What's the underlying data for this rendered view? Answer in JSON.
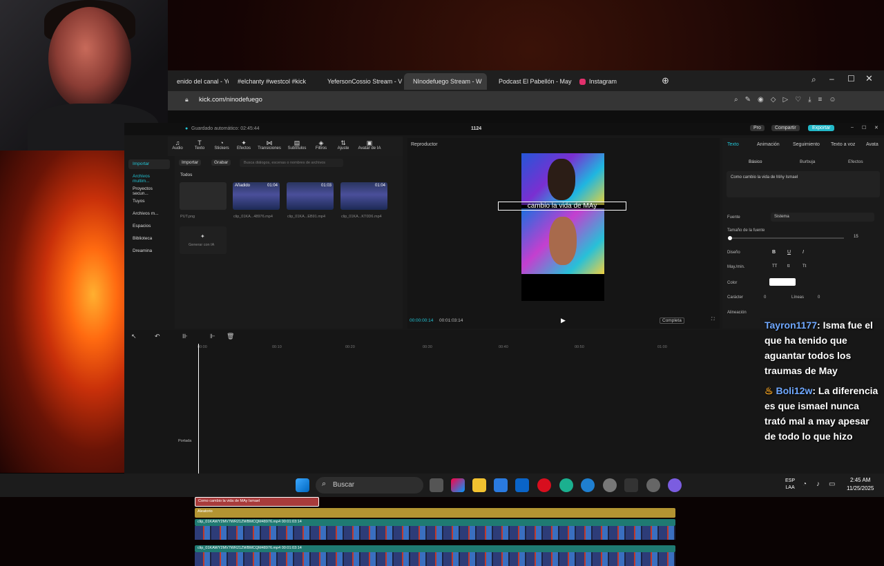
{
  "browser": {
    "tabs": [
      {
        "label": "enido del canal - You",
        "color": "#ff0000"
      },
      {
        "label": "#elchanty #westcol #kick",
        "color": "#ffffff"
      },
      {
        "label": "YefersonCossio Stream - V",
        "color": "#53fc18"
      },
      {
        "label": "NInodefuego Stream - W",
        "color": "#53fc18"
      },
      {
        "label": "Podcast El Pabellón - May",
        "color": "#ff0000"
      },
      {
        "label": "Instagram",
        "color": "#e1306c"
      }
    ],
    "url": "kick.com/ninodefuego"
  },
  "capcut": {
    "autosave": "Guardado automático: 02:45:44",
    "project": "1124",
    "pro": "Pro",
    "share": "Compartir",
    "export": "Exportar",
    "tools": [
      {
        "icon": "♫",
        "label": "Audio"
      },
      {
        "icon": "T",
        "label": "Texto"
      },
      {
        "icon": "◔",
        "label": "Stickers"
      },
      {
        "icon": "✦",
        "label": "Efectos"
      },
      {
        "icon": "⋈",
        "label": "Transiciones"
      },
      {
        "icon": "▤",
        "label": "Subtítulos"
      },
      {
        "icon": "◈",
        "label": "Filtros"
      },
      {
        "icon": "⇅",
        "label": "Ajuste"
      },
      {
        "icon": "▣",
        "label": "Avatar de IA"
      }
    ],
    "sidebar": [
      "Importar",
      "Archivos multim...",
      "Proyectos secun...",
      "Tuyos",
      "Archivos m...",
      "Espacios",
      "Biblioteca",
      "Dreamina"
    ],
    "media": {
      "import": "Importar",
      "record": "Grabar",
      "search_placeholder": "Busca diálogos, escenas o nombres de archivos",
      "all": "Todos",
      "items": [
        {
          "name": "PUT.png",
          "badge": "",
          "dur": ""
        },
        {
          "name": "clip_01KA...48976.mp4",
          "badge": "Añadido",
          "dur": "01:04"
        },
        {
          "name": "clip_01KA...EB91.mp4",
          "badge": "",
          "dur": "01:03"
        },
        {
          "name": "clip_01KA...KT0D6.mp4",
          "badge": "",
          "dur": "01:04"
        }
      ],
      "generate": "Generar con IA"
    },
    "player": {
      "title": "Reproductor",
      "subtitle": "cambio la vida de MAy",
      "current": "00:00:00:14",
      "total": "00:01:03:14",
      "ratio": "Completa"
    },
    "props": {
      "tabs": [
        "Texto",
        "Animación",
        "Seguimiento",
        "Texto a voz",
        "Avata"
      ],
      "subtabs": [
        "Básico",
        "Burbuja",
        "Efectos"
      ],
      "text_value": "Como cambio la vida de MAy Ismael",
      "font_label": "Fuente",
      "font_value": "Sistema",
      "size_label": "Tamaño de la fuente",
      "size_value": "15",
      "design_label": "Diseño",
      "case_label": "May./min.",
      "color_label": "Color",
      "char_label": "Carácter",
      "char_value": "0",
      "lines_label": "Líneas",
      "lines_value": "0",
      "align_label": "Alineación"
    },
    "timeline": {
      "ticks": [
        "00:00",
        "00:10",
        "00:20",
        "00:30",
        "00:40",
        "00:50",
        "01:00"
      ],
      "text_clip": "Como cambio la vida de MAy Ismael",
      "effect_clip": "Aleatorio",
      "clip1": "clip_01KAWY2MV7WR21ZWBMCQM48976.mp4   00:01:03:14",
      "clip2": "clip_01KAWY2MV7WR21ZWBMCQM48976.mp4   00:01:03:14",
      "cover": "Portada"
    }
  },
  "chat": [
    {
      "user": "Tayron1177",
      "text": ": Isma fue el que ha tenido que aguantar todos los traumas de May"
    },
    {
      "user": "Boli12w",
      "text": ": La diferencia es que ismael nunca trató mal a may apesar de todo lo que hizo"
    }
  ],
  "taskbar": {
    "search": "Buscar",
    "lang1": "ESP",
    "lang2": "LAA",
    "time": "2:45 AM",
    "date": "11/25/2025"
  }
}
